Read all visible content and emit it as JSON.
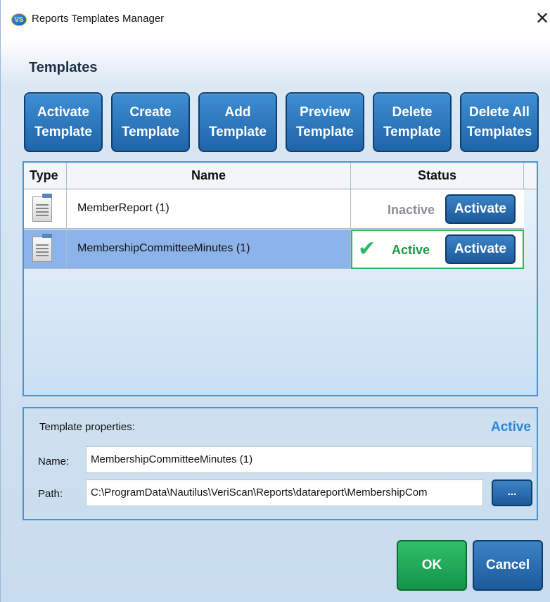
{
  "window": {
    "app_icon_text": "VS",
    "title": "Reports Templates Manager",
    "close_glyph": "✕"
  },
  "section_title": "Templates",
  "toolbar": [
    {
      "label": "Activate\nTemplate"
    },
    {
      "label": "Create\nTemplate"
    },
    {
      "label": "Add\nTemplate"
    },
    {
      "label": "Preview\nTemplate"
    },
    {
      "label": "Delete\nTemplate"
    },
    {
      "label": "Delete All\nTemplates"
    }
  ],
  "grid": {
    "columns": [
      "Type",
      "Name",
      "Status"
    ],
    "rows": [
      {
        "icon": "document-icon",
        "name": "MemberReport (1)",
        "status": "Inactive",
        "action": "Activate",
        "selected": false
      },
      {
        "icon": "document-icon",
        "name": "MembershipCommitteeMinutes (1)",
        "status": "Active",
        "action": "Activate",
        "selected": true
      }
    ]
  },
  "properties": {
    "title": "Template properties:",
    "status": "Active",
    "name_label": "Name:",
    "name_value": "MembershipCommitteeMinutes (1)",
    "path_label": "Path:",
    "path_value": "C:\\ProgramData\\Nautilus\\VeriScan\\Reports\\datareport\\MembershipCom",
    "browse_label": "..."
  },
  "footer": {
    "ok_label": "OK",
    "cancel_label": "Cancel"
  },
  "colors": {
    "accent_blue": "#1f64a8",
    "ok_green": "#139448",
    "active_text": "#1a9a4a",
    "inactive_text": "#8a8f94",
    "selected_row": "#8db4ea"
  }
}
